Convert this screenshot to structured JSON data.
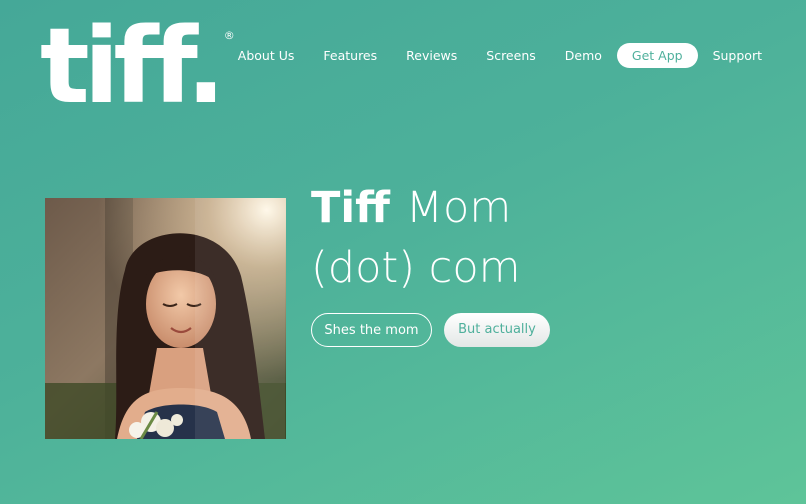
{
  "logo": {
    "text": "tiff.",
    "registered": "®"
  },
  "nav": {
    "items": [
      {
        "label": "About Us"
      },
      {
        "label": "Features"
      },
      {
        "label": "Reviews"
      },
      {
        "label": "Screens"
      },
      {
        "label": "Demo"
      },
      {
        "label": "Get App",
        "highlighted": true
      },
      {
        "label": "Support"
      }
    ]
  },
  "hero": {
    "title_bold": "Tiff",
    "title_light": "Mom",
    "title_line2": "(dot) com",
    "photo_alt": "photo of a smiling woman holding flowers",
    "buttons": {
      "primary": "Shes the mom",
      "secondary": "But actually"
    }
  },
  "colors": {
    "background_start": "#45a898",
    "background_end": "#5ec499",
    "accent_text": "#4fb09c",
    "text": "#ffffff"
  }
}
